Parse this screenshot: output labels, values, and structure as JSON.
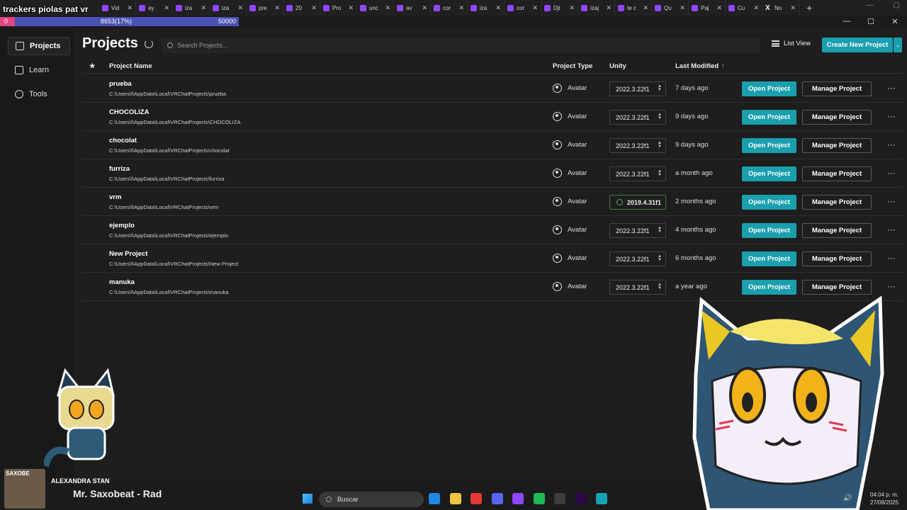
{
  "browser": {
    "tabs": [
      {
        "label": "Vid",
        "icon": "twitch-icon"
      },
      {
        "label": "ay",
        "icon": "twitch-icon"
      },
      {
        "label": "iza",
        "icon": "twitch-icon"
      },
      {
        "label": "iza",
        "icon": "twitch-icon"
      },
      {
        "label": "pre",
        "icon": "twitch-icon"
      },
      {
        "label": "20",
        "icon": "twitch-icon"
      },
      {
        "label": "Pro",
        "icon": "twitch-icon"
      },
      {
        "label": "unc",
        "icon": "twitch-icon"
      },
      {
        "label": "av",
        "icon": "twitch-icon"
      },
      {
        "label": "cor",
        "icon": "twitch-icon"
      },
      {
        "label": "iza",
        "icon": "twitch-icon"
      },
      {
        "label": "cor",
        "icon": "twitch-icon"
      },
      {
        "label": "Djt",
        "icon": "twitch-icon"
      },
      {
        "label": "izaj",
        "icon": "twitch-icon"
      },
      {
        "label": "te c",
        "icon": "twitch-icon"
      },
      {
        "label": "Qu",
        "icon": "twitch-icon"
      },
      {
        "label": "Paj",
        "icon": "twitch-icon"
      },
      {
        "label": "Cu",
        "icon": "twitch-icon"
      },
      {
        "label": "No",
        "icon": "x-icon"
      }
    ],
    "new_tab": "+"
  },
  "overlay": {
    "title": "trackers piolas pat vr",
    "progress_start": "0",
    "progress_current": "8653(17%)",
    "progress_goal": "50000",
    "progress_fraction": 0.17,
    "fill_color": "#e0467f",
    "bar_color": "#4a52b4"
  },
  "sidebar": {
    "items": [
      {
        "label": "Projects",
        "icon": "projects-icon",
        "active": true
      },
      {
        "label": "Learn",
        "icon": "learn-icon",
        "active": false
      },
      {
        "label": "Tools",
        "icon": "tools-icon",
        "active": false
      }
    ]
  },
  "header": {
    "title": "Projects",
    "search_placeholder": "Search Projects...",
    "list_view": "List View",
    "create_button": "Create New Project",
    "accent": "#1a9fae"
  },
  "table": {
    "columns": {
      "star": "★",
      "name": "Project Name",
      "type": "Project Type",
      "unity": "Unity",
      "modified": "Last Modified",
      "sort_arrow": "↑"
    },
    "open_label": "Open Project",
    "manage_label": "Manage Project",
    "more_label": "···",
    "rows": [
      {
        "name": "prueba",
        "path": "C:\\Users\\l\\AppData\\Local\\VRChatProjects\\prueba",
        "type": "Avatar",
        "unity": "2022.3.22f1",
        "modified": "7 days ago",
        "installed": false
      },
      {
        "name": "CHOCOLIZA",
        "path": "C:\\Users\\l\\AppData\\Local\\VRChatProjects\\CHOCOLIZA",
        "type": "Avatar",
        "unity": "2022.3.22f1",
        "modified": "9 days ago",
        "installed": false
      },
      {
        "name": "chocolat",
        "path": "C:\\Users\\l\\AppData\\Local\\VRChatProjects\\chocolat",
        "type": "Avatar",
        "unity": "2022.3.22f1",
        "modified": "9 days ago",
        "installed": false
      },
      {
        "name": "furriza",
        "path": "C:\\Users\\l\\AppData\\Local\\VRChatProjects\\furriza",
        "type": "Avatar",
        "unity": "2022.3.22f1",
        "modified": "a month ago",
        "installed": false
      },
      {
        "name": "vrm",
        "path": "C:\\Users\\l\\AppData\\Local\\VRChatProjects\\vrm",
        "type": "Avatar",
        "unity": "2019.4.31f1",
        "modified": "2 months ago",
        "installed": true
      },
      {
        "name": "ejemplo",
        "path": "C:\\Users\\l\\AppData\\Local\\VRChatProjects\\ejemplo",
        "type": "Avatar",
        "unity": "2022.3.22f1",
        "modified": "4 months ago",
        "installed": false
      },
      {
        "name": "New Project",
        "path": "C:\\Users\\l\\AppData\\Local\\VRChatProjects\\New Project",
        "type": "Avatar",
        "unity": "2022.3.22f1",
        "modified": "6 months ago",
        "installed": false
      },
      {
        "name": "manuka",
        "path": "C:\\Users\\l\\AppData\\Local\\VRChatProjects\\manuka",
        "type": "Avatar",
        "unity": "2022.3.22f1",
        "modified": "a year ago",
        "installed": false
      }
    ]
  },
  "now_playing": {
    "cover_label": "SAXOBE",
    "artist": "ALEXANDRA STAN",
    "song": "Mr. Saxobeat - Rad"
  },
  "taskbar": {
    "search_label": "Buscar",
    "time": "04:04 p. m.",
    "date": "27/08/2025",
    "apps": [
      "edge-icon",
      "file-explorer-icon",
      "valorant-icon",
      "discord-icon",
      "twitch-icon",
      "spotify-icon",
      "steam-icon",
      "premiere-icon",
      "vrchat-creator-icon"
    ]
  }
}
